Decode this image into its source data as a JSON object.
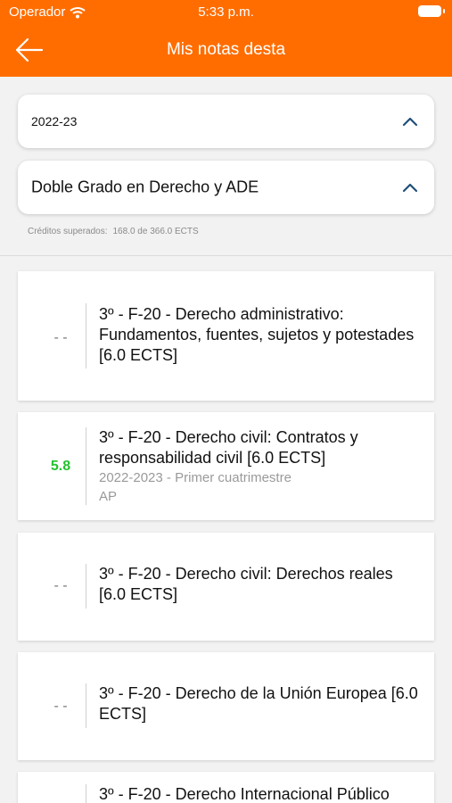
{
  "status_bar": {
    "carrier": "Operador",
    "time": "5:33 p.m."
  },
  "header": {
    "title": "Mis notas desta"
  },
  "filters": {
    "year": "2022-23",
    "degree": "Doble Grado en Derecho y ADE",
    "credits_label": "Créditos superados:",
    "credits_value": "168.0 de 366.0 ECTS"
  },
  "subjects": [
    {
      "grade": "- -",
      "title": "3º - F-20 - Derecho administrativo: Fundamentos, fuentes, sujetos y potestades [6.0 ECTS]",
      "period": "",
      "status": ""
    },
    {
      "grade": "5.8",
      "title": "3º - F-20 - Derecho civil: Contratos y responsabilidad civil [6.0 ECTS]",
      "period": "2022-2023 - Primer cuatrimestre",
      "status": "AP"
    },
    {
      "grade": "- -",
      "title": "3º - F-20 - Derecho civil: Derechos reales [6.0 ECTS]",
      "period": "",
      "status": ""
    },
    {
      "grade": "- -",
      "title": "3º - F-20 - Derecho de la Unión Europea [6.0 ECTS]",
      "period": "",
      "status": ""
    },
    {
      "grade": "",
      "title": "3º - F-20 - Derecho Internacional Público",
      "period": "",
      "status": ""
    }
  ],
  "colors": {
    "header": "#ff6d00",
    "passed_grade": "#25c22f",
    "chevron": "#1f4f7a"
  },
  "icons": {
    "back": "arrow-left-icon",
    "expand": "chevron-up-icon",
    "wifi": "wifi-icon",
    "battery": "battery-icon"
  }
}
